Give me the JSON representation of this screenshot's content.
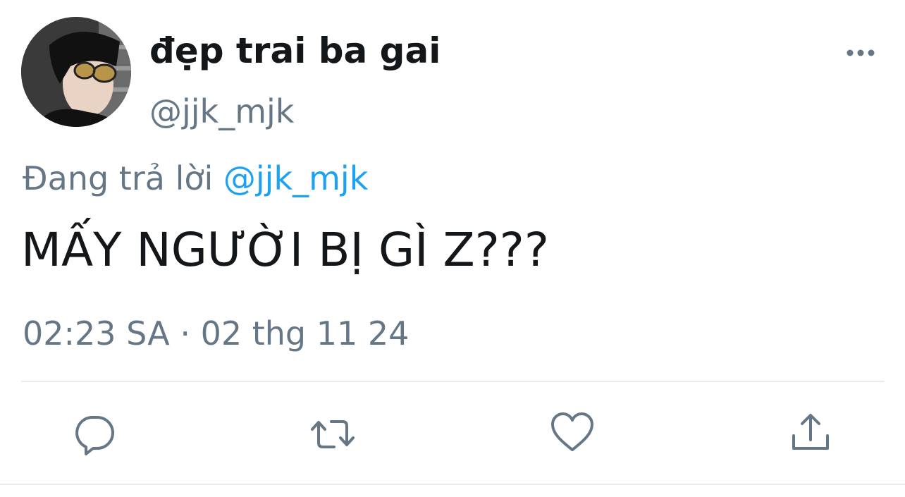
{
  "user": {
    "display_name": "đẹp trai ba gai",
    "handle": "@jjk_mjk"
  },
  "reply": {
    "prefix": "Đang trả lời ",
    "mention": "@jjk_mjk"
  },
  "tweet": {
    "text": "MẤY NGƯỜI BỊ GÌ Z???",
    "timestamp": "02:23 SA · 02 thg 11 24"
  },
  "actions": [
    {
      "icon": "reply-icon"
    },
    {
      "icon": "retweet-icon"
    },
    {
      "icon": "like-icon"
    },
    {
      "icon": "share-icon"
    }
  ],
  "colors": {
    "text_primary": "#14171a",
    "text_secondary": "#657786",
    "link": "#1da1f2",
    "divider": "#e6ecf0"
  }
}
